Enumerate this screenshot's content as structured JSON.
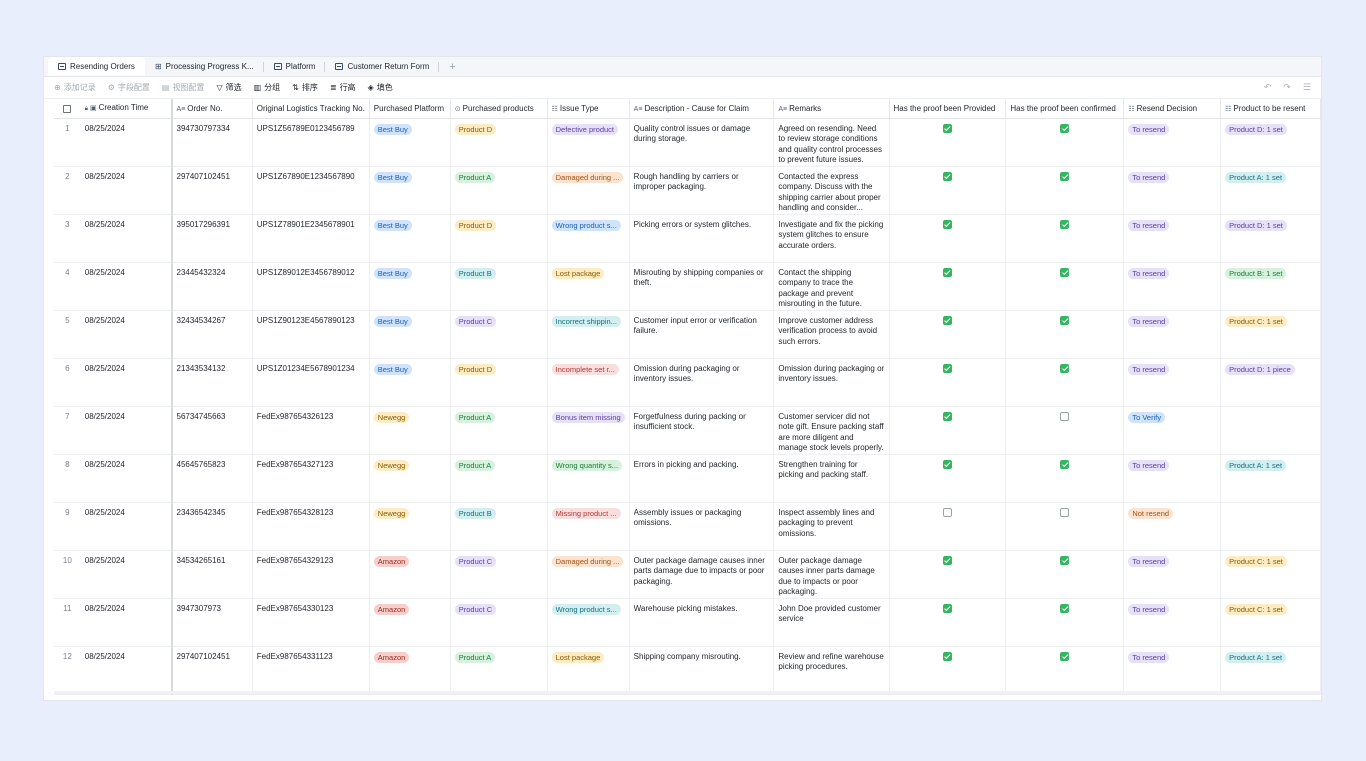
{
  "tabs": [
    {
      "label": "Resending Orders",
      "active": true
    },
    {
      "label": "Processing Progress K...",
      "active": false
    },
    {
      "label": "Platform",
      "active": false
    },
    {
      "label": "Customer Return Form",
      "active": false
    }
  ],
  "tab_add": "+",
  "toolbar": {
    "add_record": "添加记录",
    "field_config": "字段配置",
    "view_config": "视图配置",
    "filter": "筛选",
    "group": "分组",
    "sort": "排序",
    "row_height": "行高",
    "fill_color": "填色",
    "undo": "↶",
    "redo": "↷",
    "more": "☰"
  },
  "columns": [
    {
      "label": "Creation Time",
      "icon": "▣"
    },
    {
      "label": "Order No.",
      "icon": "A≡"
    },
    {
      "label": "Original Logistics Tracking No.",
      "icon": ""
    },
    {
      "label": "Purchased Platform",
      "icon": ""
    },
    {
      "label": "Purchased products",
      "icon": "⊙"
    },
    {
      "label": "Issue Type",
      "icon": "☷"
    },
    {
      "label": "Description - Cause for Claim",
      "icon": "A≡"
    },
    {
      "label": "Remarks",
      "icon": "A≡"
    },
    {
      "label": "Has the proof been Provided",
      "icon": ""
    },
    {
      "label": "Has the proof been confirmed",
      "icon": ""
    },
    {
      "label": "Resend Decision",
      "icon": "☷"
    },
    {
      "label": "Product to be resent",
      "icon": "☷"
    }
  ],
  "colors": {
    "blue_bg": "#cfe3fb",
    "blue_fg": "#1d5fb8",
    "yellow_bg": "#fcecc4",
    "yellow_fg": "#8a5a00",
    "green_bg": "#d6f1dc",
    "green_fg": "#1f7a3a",
    "purple_bg": "#e6e1f7",
    "purple_fg": "#5b3fa8",
    "teal_bg": "#d2eef0",
    "teal_fg": "#16707a",
    "pink_bg": "#f9dede",
    "pink_fg": "#b33a3a",
    "orange_bg": "#fbe3cf",
    "orange_fg": "#a4541a",
    "amazon_bg": "#f6cfcb",
    "amazon_fg": "#9c2a22",
    "check_green": "#34b661"
  },
  "rows": [
    {
      "idx": "1",
      "time": "08/25/2024",
      "order": "394730797334",
      "tracking": "UPS1Z56789E0123456789",
      "platform": {
        "text": "Best Buy",
        "c": "blue"
      },
      "product": {
        "text": "Product D",
        "c": "yellow"
      },
      "issue": {
        "text": "Defective product",
        "c": "purple"
      },
      "desc": "Quality control issues or damage during storage.",
      "remarks": "Agreed on resending. Need to review storage conditions and quality control processes to prevent future issues.",
      "provided": true,
      "confirmed": true,
      "decision": {
        "text": "To resend",
        "c": "purple"
      },
      "resend": {
        "text": "Product D: 1 set",
        "c": "purple"
      }
    },
    {
      "idx": "2",
      "time": "08/25/2024",
      "order": "297407102451",
      "tracking": "UPS1Z67890E1234567890",
      "platform": {
        "text": "Best Buy",
        "c": "blue"
      },
      "product": {
        "text": "Product A",
        "c": "green"
      },
      "issue": {
        "text": "Damaged during ...",
        "c": "orange"
      },
      "desc": "Rough handling by carriers or improper packaging.",
      "remarks": "Contacted the express company. Discuss with the shipping carrier about proper handling and consider...",
      "provided": true,
      "confirmed": true,
      "decision": {
        "text": "To resend",
        "c": "purple"
      },
      "resend": {
        "text": "Product A: 1 set",
        "c": "teal"
      }
    },
    {
      "idx": "3",
      "time": "08/25/2024",
      "order": "395017296391",
      "tracking": "UPS1Z78901E2345678901",
      "platform": {
        "text": "Best Buy",
        "c": "blue"
      },
      "product": {
        "text": "Product D",
        "c": "yellow"
      },
      "issue": {
        "text": "Wrong product s...",
        "c": "blue"
      },
      "desc": "Picking errors or system glitches.",
      "remarks": "Investigate and fix the picking system glitches to ensure accurate orders.",
      "provided": true,
      "confirmed": true,
      "decision": {
        "text": "To resend",
        "c": "purple"
      },
      "resend": {
        "text": "Product D: 1 set",
        "c": "purple"
      }
    },
    {
      "idx": "4",
      "time": "08/25/2024",
      "order": "23445432324",
      "tracking": "UPS1Z89012E3456789012",
      "platform": {
        "text": "Best Buy",
        "c": "blue"
      },
      "product": {
        "text": "Product B",
        "c": "teal"
      },
      "issue": {
        "text": "Lost package",
        "c": "yellow"
      },
      "desc": "Misrouting by shipping companies or theft.",
      "remarks": "Contact the shipping company to trace the package and prevent misrouting in the future.",
      "provided": true,
      "confirmed": true,
      "decision": {
        "text": "To resend",
        "c": "purple"
      },
      "resend": {
        "text": "Product B: 1 set",
        "c": "green"
      }
    },
    {
      "idx": "5",
      "time": "08/25/2024",
      "order": "32434534267",
      "tracking": "UPS1Z90123E4567890123",
      "platform": {
        "text": "Best Buy",
        "c": "blue"
      },
      "product": {
        "text": "Product C",
        "c": "purple"
      },
      "issue": {
        "text": "Incorrect shippin...",
        "c": "teal"
      },
      "desc": "Customer input error or verification failure.",
      "remarks": "Improve customer address verification process to avoid such errors.",
      "provided": true,
      "confirmed": true,
      "decision": {
        "text": "To resend",
        "c": "purple"
      },
      "resend": {
        "text": "Product C: 1 set",
        "c": "yellow"
      }
    },
    {
      "idx": "6",
      "time": "08/25/2024",
      "order": "21343534132",
      "tracking": "UPS1Z01234E5678901234",
      "platform": {
        "text": "Best Buy",
        "c": "blue"
      },
      "product": {
        "text": "Product D",
        "c": "yellow"
      },
      "issue": {
        "text": "Incomplete set r...",
        "c": "pink"
      },
      "desc": "Omission during packaging or inventory issues.",
      "remarks": "Omission during packaging or inventory issues.",
      "provided": true,
      "confirmed": true,
      "decision": {
        "text": "To resend",
        "c": "purple"
      },
      "resend": {
        "text": "Product D: 1 piece",
        "c": "purple"
      }
    },
    {
      "idx": "7",
      "time": "08/25/2024",
      "order": "56734745663",
      "tracking": "FedEx987654326123",
      "platform": {
        "text": "Newegg",
        "c": "yellow"
      },
      "product": {
        "text": "Product A",
        "c": "green"
      },
      "issue": {
        "text": "Bonus item missing",
        "c": "purple"
      },
      "desc": "Forgetfulness during packing or insufficient stock.",
      "remarks": "Customer servicer did not note gift. Ensure packing staff are more diligent and manage stock levels properly.",
      "provided": true,
      "confirmed": false,
      "decision": {
        "text": "To Verify",
        "c": "blue"
      },
      "resend": null
    },
    {
      "idx": "8",
      "time": "08/25/2024",
      "order": "45645765823",
      "tracking": "FedEx987654327123",
      "platform": {
        "text": "Newegg",
        "c": "yellow"
      },
      "product": {
        "text": "Product A",
        "c": "green"
      },
      "issue": {
        "text": "Wrong quantity s...",
        "c": "green"
      },
      "desc": "Errors in picking and packing.",
      "remarks": "Strengthen training for picking and packing staff.",
      "provided": true,
      "confirmed": true,
      "decision": {
        "text": "To resend",
        "c": "purple"
      },
      "resend": {
        "text": "Product A: 1 set",
        "c": "teal"
      }
    },
    {
      "idx": "9",
      "time": "08/25/2024",
      "order": "23436542345",
      "tracking": "FedEx987654328123",
      "platform": {
        "text": "Newegg",
        "c": "yellow"
      },
      "product": {
        "text": "Product B",
        "c": "teal"
      },
      "issue": {
        "text": "Missing product ...",
        "c": "pink"
      },
      "desc": "Assembly issues or packaging omissions.",
      "remarks": "Inspect assembly lines and packaging to prevent omissions.",
      "provided": false,
      "confirmed": false,
      "decision": {
        "text": "Not resend",
        "c": "orange"
      },
      "resend": null
    },
    {
      "idx": "10",
      "time": "08/25/2024",
      "order": "34534265161",
      "tracking": "FedEx987654329123",
      "platform": {
        "text": "Amazon",
        "c": "amazon"
      },
      "product": {
        "text": "Product C",
        "c": "purple"
      },
      "issue": {
        "text": "Damaged during ...",
        "c": "orange"
      },
      "desc": "Outer package damage causes inner parts damage due to impacts or poor packaging.",
      "remarks": "Outer package damage causes inner parts damage due to impacts or poor packaging.",
      "provided": true,
      "confirmed": true,
      "decision": {
        "text": "To resend",
        "c": "purple"
      },
      "resend": {
        "text": "Product C: 1 set",
        "c": "yellow"
      }
    },
    {
      "idx": "11",
      "time": "08/25/2024",
      "order": "3947307973",
      "tracking": "FedEx987654330123",
      "platform": {
        "text": "Amazon",
        "c": "amazon"
      },
      "product": {
        "text": "Product C",
        "c": "purple"
      },
      "issue": {
        "text": "Wrong product s...",
        "c": "teal"
      },
      "desc": "Warehouse picking mistakes.",
      "remarks": "John Doe provided customer service",
      "provided": true,
      "confirmed": true,
      "decision": {
        "text": "To resend",
        "c": "purple"
      },
      "resend": {
        "text": "Product C: 1 set",
        "c": "yellow"
      }
    },
    {
      "idx": "12",
      "time": "08/25/2024",
      "order": "297407102451",
      "tracking": "FedEx987654331123",
      "platform": {
        "text": "Amazon",
        "c": "amazon"
      },
      "product": {
        "text": "Product A",
        "c": "green"
      },
      "issue": {
        "text": "Lost package",
        "c": "yellow"
      },
      "desc": "Shipping company misrouting.",
      "remarks": "Review and refine warehouse picking procedures.",
      "provided": true,
      "confirmed": true,
      "decision": {
        "text": "To resend",
        "c": "purple"
      },
      "resend": {
        "text": "Product A: 1 set",
        "c": "teal"
      }
    }
  ]
}
